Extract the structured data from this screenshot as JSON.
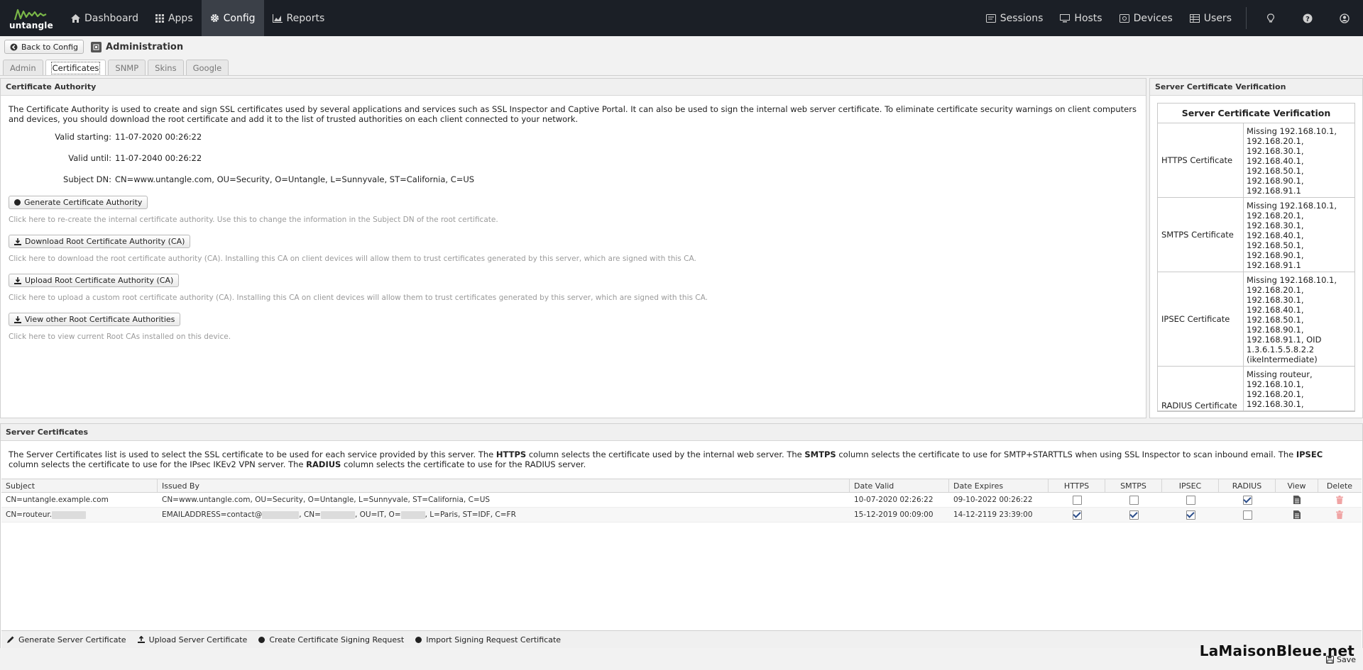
{
  "nav": {
    "logo_text": "untangle",
    "left": [
      {
        "label": "Dashboard",
        "icon": "home-icon"
      },
      {
        "label": "Apps",
        "icon": "grid-icon"
      },
      {
        "label": "Config",
        "icon": "gear-icon",
        "active": true
      },
      {
        "label": "Reports",
        "icon": "area-chart-icon"
      }
    ],
    "right": [
      {
        "label": "Sessions",
        "icon": "sessions-icon"
      },
      {
        "label": "Hosts",
        "icon": "hosts-icon"
      },
      {
        "label": "Devices",
        "icon": "devices-icon"
      },
      {
        "label": "Users",
        "icon": "users-icon"
      }
    ]
  },
  "adminbar": {
    "back_label": "Back to Config",
    "title": "Administration"
  },
  "tabs": [
    "Admin",
    "Certificates",
    "SNMP",
    "Skins",
    "Google"
  ],
  "ca": {
    "header": "Certificate Authority",
    "description": "The Certificate Authority is used to create and sign SSL certificates used by several applications and services such as SSL Inspector and Captive Portal. It can also be used to sign the internal web server certificate. To eliminate certificate security warnings on client computers and devices, you should download the root certificate and add it to the list of trusted authorities on each client connected to your network.",
    "fields": [
      {
        "label": "Valid starting:",
        "value": "11-07-2020 00:26:22"
      },
      {
        "label": "Valid until:",
        "value": "11-07-2040 00:26:22"
      },
      {
        "label": "Subject DN:",
        "value": "CN=www.untangle.com, OU=Security, O=Untangle, L=Sunnyvale, ST=California, C=US"
      }
    ],
    "actions": [
      {
        "label": "Generate Certificate Authority",
        "hint": "Click here to re-create the internal certificate authority. Use this to change the information in the Subject DN of the root certificate."
      },
      {
        "label": "Download Root Certificate Authority (CA)",
        "hint": "Click here to download the root certificate authority (CA). Installing this CA on client devices will allow them to trust certificates generated by this server, which are signed with this CA."
      },
      {
        "label": "Upload Root Certificate Authority (CA)",
        "hint": "Click here to upload a custom root certificate authority (CA). Installing this CA on client devices will allow them to trust certificates generated by this server, which are signed with this CA."
      },
      {
        "label": "View other Root Certificate Authorities",
        "hint": "Click here to view current Root CAs installed on this device."
      }
    ]
  },
  "verification": {
    "header": "Server Certificate Verification",
    "title": "Server Certificate Verification",
    "rows": [
      {
        "name": "HTTPS Certificate",
        "message": "Missing 192.168.10.1,\n192.168.20.1,\n192.168.30.1,\n192.168.40.1,\n192.168.50.1,\n192.168.90.1,\n192.168.91.1"
      },
      {
        "name": "SMTPS Certificate",
        "message": "Missing 192.168.10.1,\n192.168.20.1,\n192.168.30.1,\n192.168.40.1,\n192.168.50.1,\n192.168.90.1,\n192.168.91.1"
      },
      {
        "name": "IPSEC Certificate",
        "message": "Missing 192.168.10.1,\n192.168.20.1,\n192.168.30.1,\n192.168.40.1,\n192.168.50.1,\n192.168.90.1,\n192.168.91.1, OID\n1.3.6.1.5.5.8.2.2\n(ikeIntermediate)"
      },
      {
        "name": "RADIUS Certificate",
        "message": "Missing routeur,\n192.168.10.1,\n192.168.20.1,\n192.168.30.1,"
      }
    ]
  },
  "server_certs": {
    "header": "Server Certificates",
    "desc_1": "The Server Certificates list is used to select the SSL certificate to be used for each service provided by this server. The ",
    "desc_https": "HTTPS",
    "desc_2": " column selects the certificate used by the internal web server. The ",
    "desc_smtps": "SMTPS",
    "desc_3": " column selects the certificate to use for SMTP+STARTTLS when using SSL Inspector to scan inbound email. The ",
    "desc_ipsec": "IPSEC",
    "desc_4": " column selects the certificate to use for the IPsec IKEv2 VPN server. The ",
    "desc_radius": "RADIUS",
    "desc_5": " column selects the certificate to use for the RADIUS server.",
    "columns": [
      "Subject",
      "Issued By",
      "Date Valid",
      "Date Expires",
      "HTTPS",
      "SMTPS",
      "IPSEC",
      "RADIUS",
      "View",
      "Delete"
    ],
    "rows": [
      {
        "subject": "CN=untangle.example.com",
        "issued_by": "CN=www.untangle.com, OU=Security, O=Untangle, L=Sunnyvale, ST=California, C=US",
        "date_valid": "10-07-2020 02:26:22",
        "date_expires": "09-10-2022 00:26:22",
        "https": false,
        "smtps": false,
        "ipsec": false,
        "radius": true
      },
      {
        "subject_prefix": "CN=routeur.",
        "issued_a": "EMAILADDRESS=contact@",
        "issued_b": ", CN=",
        "issued_c": ", OU=IT, O=",
        "issued_d": ", L=Paris, ST=IDF, C=FR",
        "date_valid": "15-12-2019 00:09:00",
        "date_expires": "14-12-2119 23:39:00",
        "https": true,
        "smtps": true,
        "ipsec": true,
        "radius": false
      }
    ],
    "toolbar": [
      "Generate Server Certificate",
      "Upload Server Certificate",
      "Create Certificate Signing Request",
      "Import Signing Request Certificate"
    ]
  },
  "watermark": "LaMaisonBleue.net",
  "save_label": "Save"
}
